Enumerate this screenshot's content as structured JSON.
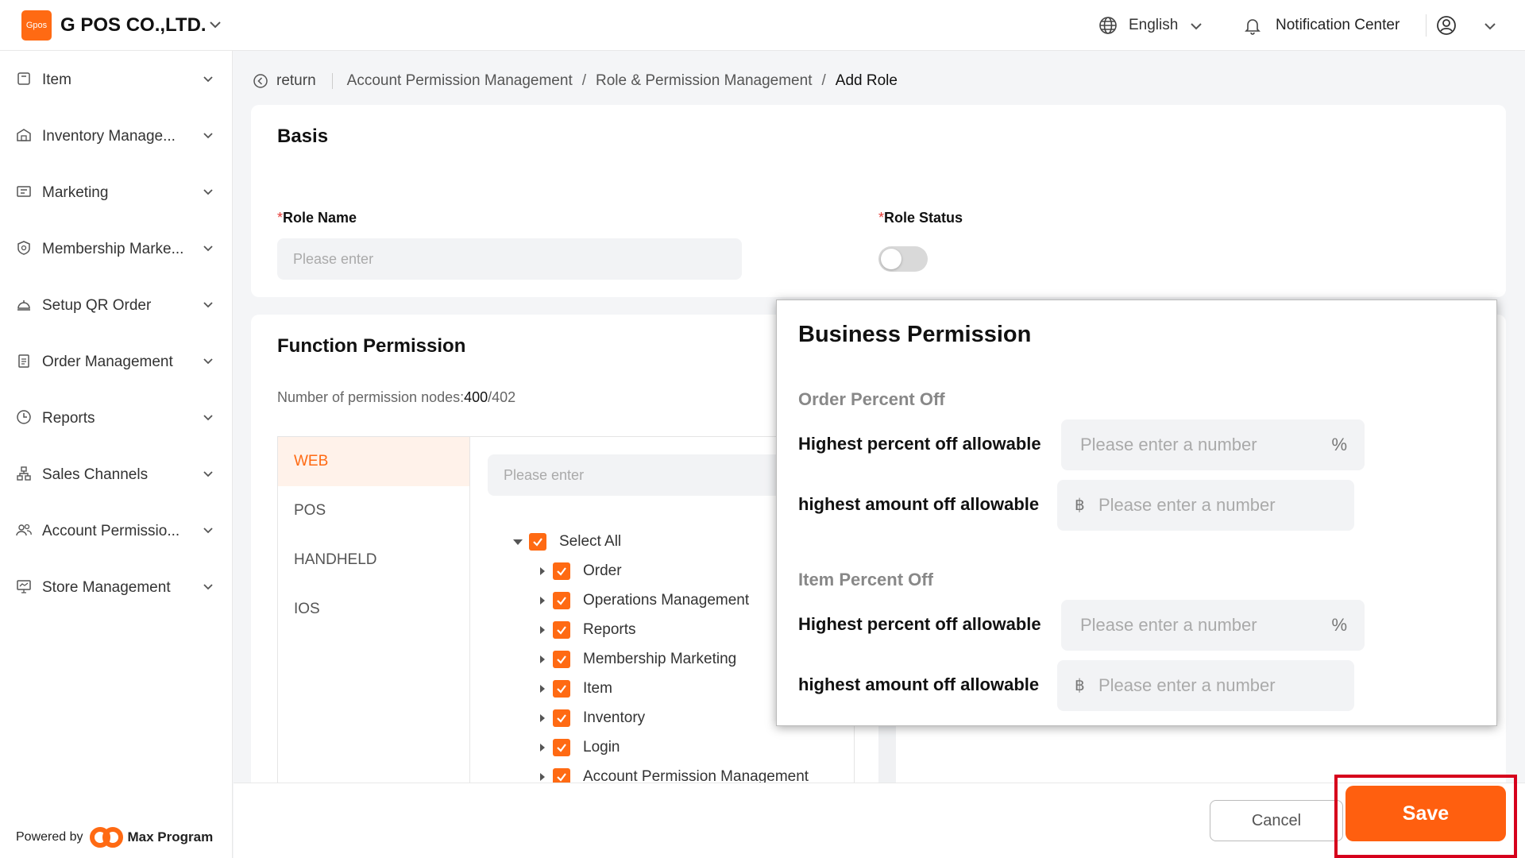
{
  "header": {
    "logo_text": "Gpos",
    "company": "G POS CO.,LTD.",
    "language": "English",
    "notification": "Notification Center"
  },
  "sidebar": {
    "items": [
      {
        "label": "Item",
        "icon": "item-icon"
      },
      {
        "label": "Inventory Manage...",
        "icon": "warehouse-icon"
      },
      {
        "label": "Marketing",
        "icon": "coupon-icon"
      },
      {
        "label": "Membership Marke...",
        "icon": "membership-icon"
      },
      {
        "label": "Setup QR Order",
        "icon": "service-bell-icon"
      },
      {
        "label": "Order Management",
        "icon": "clipboard-icon"
      },
      {
        "label": "Reports",
        "icon": "clock-icon"
      },
      {
        "label": "Sales Channels",
        "icon": "sitemap-icon"
      },
      {
        "label": "Account Permissio...",
        "icon": "users-icon"
      },
      {
        "label": "Store Management",
        "icon": "monitor-icon"
      }
    ],
    "powered_by": "Powered by",
    "powered_brand": "Max Program"
  },
  "breadcrumb": {
    "return_label": "return",
    "items": [
      "Account Permission Management",
      "Role & Permission Management"
    ],
    "current": "Add Role"
  },
  "basis": {
    "title": "Basis",
    "role_name_label": "Role Name",
    "role_name_placeholder": "Please enter",
    "role_status_label": "Role Status",
    "role_status_on": false,
    "required_mark": "*"
  },
  "function_permission": {
    "title": "Function Permission",
    "count_label": "Number of permission nodes:",
    "count_selected": "400",
    "count_total": "/402",
    "tabs": [
      "WEB",
      "POS",
      "HANDHELD",
      "IOS"
    ],
    "active_tab": "WEB",
    "search_placeholder": "Please enter",
    "tree": {
      "select_all": "Select All",
      "nodes": [
        "Order",
        "Operations Management",
        "Reports",
        "Membership Marketing",
        "Item",
        "Inventory",
        "Login",
        "Account Permission Management"
      ]
    }
  },
  "business_permission": {
    "title": "Business Permission",
    "order_section": "Order Percent Off",
    "item_section": "Item Percent Off",
    "highest_percent_label": "Highest percent off allowable",
    "highest_amount_label": "highest amount off allowable",
    "number_placeholder": "Please enter a number",
    "percent_suffix": "%",
    "currency_prefix": "฿"
  },
  "footer": {
    "cancel": "Cancel",
    "save": "Save"
  },
  "colors": {
    "brand": "#ff6a13",
    "save_button": "#ff5f0f",
    "highlight_frame": "#d6001c",
    "required": "#e53935"
  }
}
